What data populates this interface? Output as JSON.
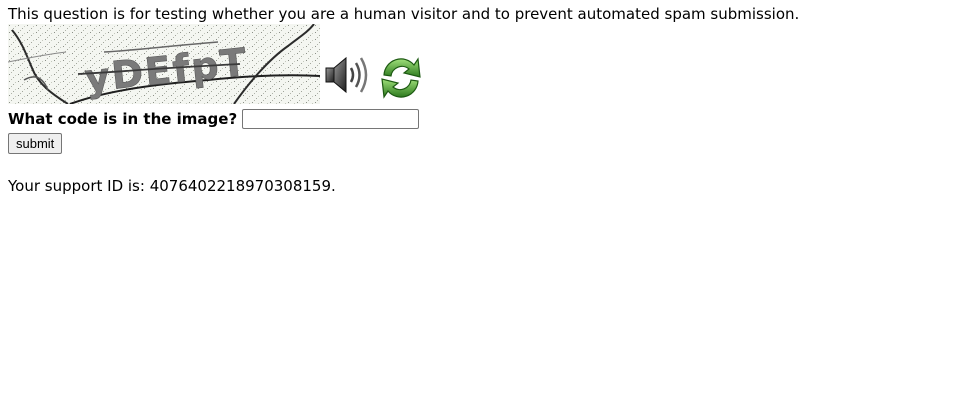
{
  "intro_text": "This question is for testing whether you are a human visitor and to prevent automated spam submission.",
  "captcha": {
    "image_text": "yDEfpT",
    "audio_icon": "speaker-icon",
    "refresh_icon": "refresh-icon"
  },
  "question": {
    "label": "What code is in the image?",
    "value": "",
    "placeholder": ""
  },
  "submit_label": "submit",
  "support": {
    "text": "Your support ID is: 4076402218970308159."
  },
  "colors": {
    "captcha_background": "#f4f6f1",
    "captcha_text": "#7a7a7a",
    "refresh_green": "#3c9a2a"
  }
}
